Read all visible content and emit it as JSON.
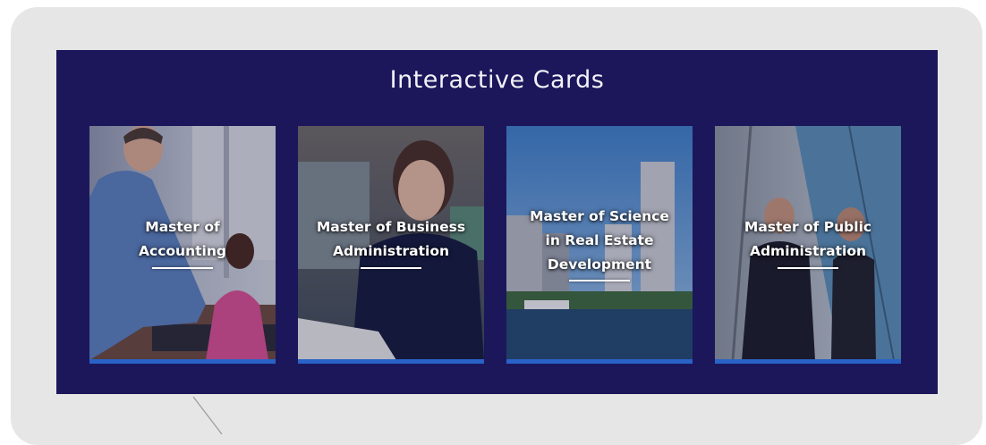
{
  "panel": {
    "title": "Interactive Cards"
  },
  "cards": [
    {
      "label_lines": [
        "Master of",
        "Accounting"
      ],
      "image": "teacher-with-student-photo"
    },
    {
      "label_lines": [
        "Master of Business",
        "Administration"
      ],
      "image": "woman-reading-photo"
    },
    {
      "label_lines": [
        "Master of Science",
        "in Real Estate",
        "Development"
      ],
      "image": "waterfront-city-photo"
    },
    {
      "label_lines": [
        "Master of Public",
        "Administration"
      ],
      "image": "handshake-photo"
    }
  ],
  "colors": {
    "panel_background": "#1c175b",
    "card_accent_bar": "#2a62c7",
    "frame_background": "#e6e6e6"
  }
}
